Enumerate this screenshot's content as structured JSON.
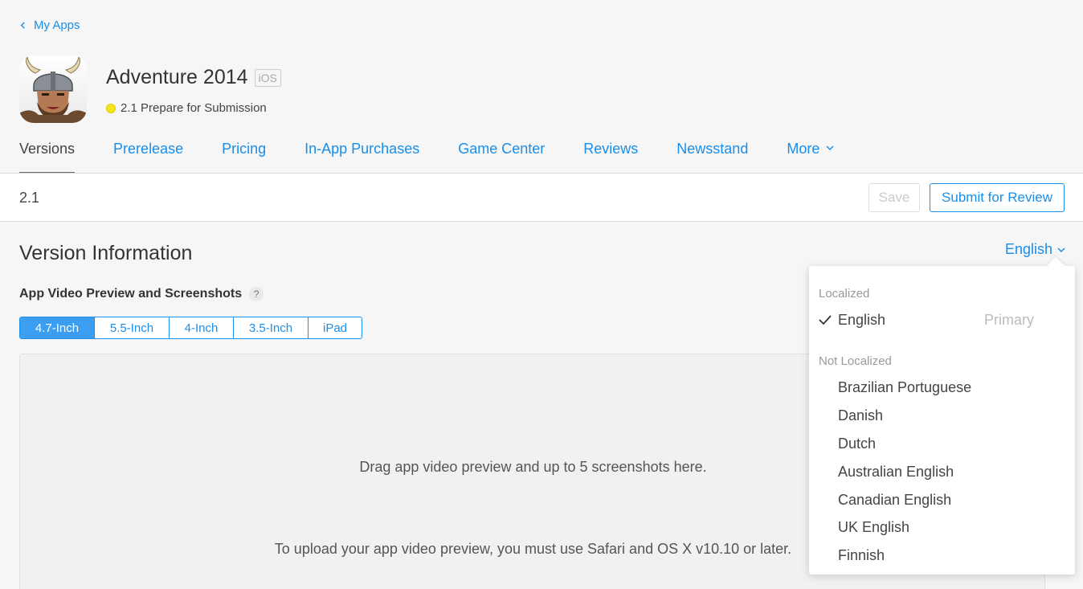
{
  "header": {
    "back_label": "My Apps",
    "app_title": "Adventure 2014",
    "platform": "iOS",
    "status": "2.1 Prepare for Submission",
    "status_color": "#f2e61a"
  },
  "tabs": [
    {
      "label": "Versions",
      "active": true
    },
    {
      "label": "Prerelease"
    },
    {
      "label": "Pricing"
    },
    {
      "label": "In-App Purchases"
    },
    {
      "label": "Game Center"
    },
    {
      "label": "Reviews"
    },
    {
      "label": "Newsstand"
    },
    {
      "label": "More"
    }
  ],
  "version_bar": {
    "version": "2.1",
    "save_label": "Save",
    "submit_label": "Submit for Review"
  },
  "section": {
    "title": "Version Information",
    "language": "English",
    "media_label": "App Video Preview and Screenshots",
    "help_glyph": "?"
  },
  "device_tabs": [
    {
      "label": "4.7-Inch",
      "active": true
    },
    {
      "label": "5.5-Inch"
    },
    {
      "label": "4-Inch"
    },
    {
      "label": "3.5-Inch"
    },
    {
      "label": "iPad"
    }
  ],
  "dropzone": {
    "line1": "Drag app video preview and up to 5 screenshots here.",
    "line2": "To upload your app video preview, you must use Safari and OS X v10.10 or later."
  },
  "language_menu": {
    "localized_heading": "Localized",
    "localized": [
      {
        "label": "English",
        "checked": true,
        "tag": "Primary"
      }
    ],
    "not_localized_heading": "Not Localized",
    "not_localized": [
      "Brazilian Portuguese",
      "Danish",
      "Dutch",
      "Australian English",
      "Canadian English",
      "UK English",
      "Finnish"
    ]
  },
  "colors": {
    "accent": "#1a8ee8",
    "background": "#f6f6f6"
  }
}
